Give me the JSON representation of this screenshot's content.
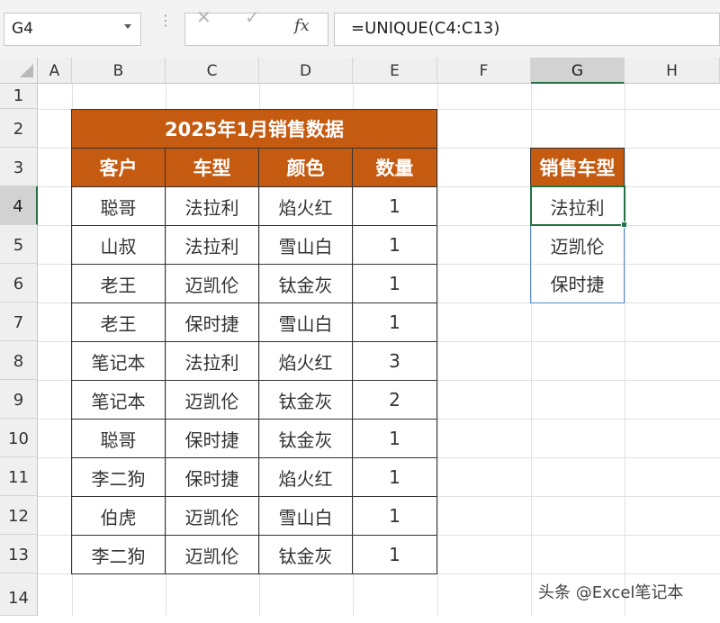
{
  "formula_bar": {
    "name_box": "G4",
    "formula": "=UNIQUE(C4:C13)",
    "fx_label": "fx"
  },
  "columns": [
    "A",
    "B",
    "C",
    "D",
    "E",
    "F",
    "G",
    "H"
  ],
  "rows": [
    "1",
    "2",
    "3",
    "4",
    "5",
    "6",
    "7",
    "8",
    "9",
    "10",
    "11",
    "12",
    "13",
    "14"
  ],
  "source_table": {
    "title": "2025年1月销售数据",
    "headers": [
      "客户",
      "车型",
      "颜色",
      "数量"
    ],
    "data": [
      [
        "聪哥",
        "法拉利",
        "焰火红",
        "1"
      ],
      [
        "山叔",
        "法拉利",
        "雪山白",
        "1"
      ],
      [
        "老王",
        "迈凯伦",
        "钛金灰",
        "1"
      ],
      [
        "老王",
        "保时捷",
        "雪山白",
        "1"
      ],
      [
        "笔记本",
        "法拉利",
        "焰火红",
        "3"
      ],
      [
        "笔记本",
        "迈凯伦",
        "钛金灰",
        "2"
      ],
      [
        "聪哥",
        "保时捷",
        "钛金灰",
        "1"
      ],
      [
        "李二狗",
        "保时捷",
        "焰火红",
        "1"
      ],
      [
        "伯虎",
        "迈凯伦",
        "雪山白",
        "1"
      ],
      [
        "李二狗",
        "迈凯伦",
        "钛金灰",
        "1"
      ]
    ]
  },
  "result_table": {
    "header": "销售车型",
    "values": [
      "法拉利",
      "迈凯伦",
      "保时捷"
    ]
  },
  "selected_cell": "G4",
  "watermark": "头条 @Excel笔记本",
  "colors": {
    "header_fill": "#c55a11",
    "selection": "#217346"
  }
}
